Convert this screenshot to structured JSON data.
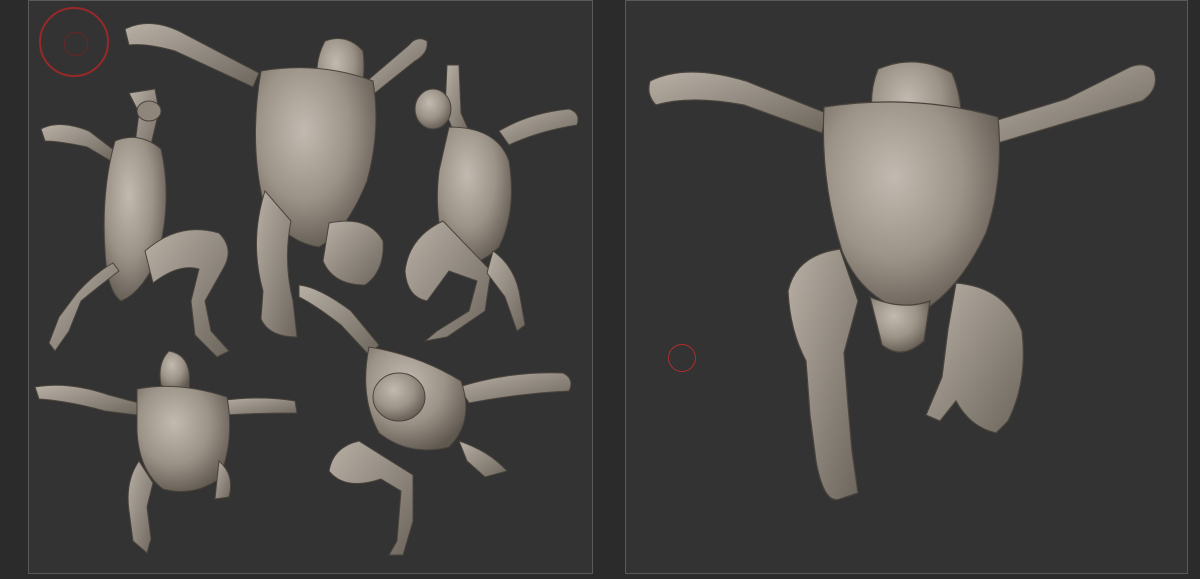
{
  "viewport_left": {
    "figures": [
      "sculpt-pose-back-left",
      "sculpt-pose-front",
      "sculpt-pose-side-right",
      "sculpt-pose-back-crouch",
      "sculpt-pose-top-down"
    ]
  },
  "viewport_right": {
    "figures": [
      "sculpt-pose-front-closeup"
    ]
  },
  "colors": {
    "background": "#2b2b2b",
    "viewport": "#333333",
    "border": "#5a5a5a",
    "clay": "#9e958a",
    "clay_shadow": "#6e665c",
    "clay_highlight": "#bdb5aa",
    "brush_cursor": "#b02c2c"
  }
}
